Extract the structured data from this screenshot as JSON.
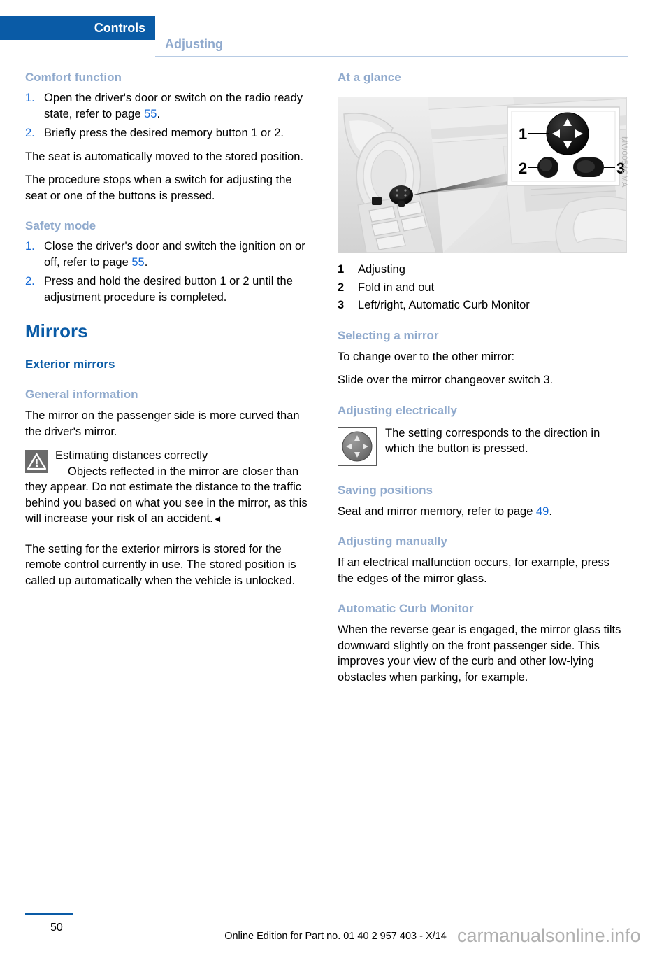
{
  "header": {
    "tab_label": "Controls",
    "section_label": "Adjusting"
  },
  "left_column": {
    "comfort_function": {
      "heading": "Comfort function",
      "steps": [
        {
          "num": "1.",
          "text_before": "Open the driver's door or switch on the radio ready state, refer to page ",
          "page_ref": "55",
          "text_after": "."
        },
        {
          "num": "2.",
          "text_before": "Briefly press the desired memory button 1 or 2.",
          "page_ref": "",
          "text_after": ""
        }
      ],
      "paragraphs": [
        "The seat is automatically moved to the stored position.",
        "The procedure stops when a switch for adjusting the seat or one of the buttons is pressed."
      ]
    },
    "safety_mode": {
      "heading": "Safety mode",
      "steps": [
        {
          "num": "1.",
          "text_before": "Close the driver's door and switch the ignition on or off, refer to page ",
          "page_ref": "55",
          "text_after": "."
        },
        {
          "num": "2.",
          "text_before": "Press and hold the desired button 1 or 2 until the adjustment procedure is completed.",
          "page_ref": "",
          "text_after": ""
        }
      ]
    },
    "mirrors": {
      "heading": "Mirrors",
      "subheading": "Exterior mirrors",
      "general_information": {
        "heading": "General information",
        "paragraph": "The mirror on the passenger side is more curved than the driver's mirror."
      },
      "warning": {
        "icon": "warning-triangle-icon",
        "title": "Estimating distances correctly",
        "text": "Objects reflected in the mirror are closer than they appear. Do not estimate the distance to the traffic behind you based on what you see in the mirror, as this will increase your risk of an accident.",
        "end_mark": "◄"
      },
      "closing_paragraph": "The setting for the exterior mirrors is stored for the remote control currently in use. The stored position is called up automatically when the vehicle is unlocked."
    }
  },
  "right_column": {
    "at_a_glance": {
      "heading": "At a glance",
      "figure": {
        "caption_code": "MW0054CMA",
        "callout_labels": [
          "1",
          "2",
          "3"
        ]
      },
      "legend": [
        {
          "num": "1",
          "label": "Adjusting"
        },
        {
          "num": "2",
          "label": "Fold in and out"
        },
        {
          "num": "3",
          "label": "Left/right, Automatic Curb Monitor"
        }
      ]
    },
    "selecting_a_mirror": {
      "heading": "Selecting a mirror",
      "paragraphs": [
        "To change over to the other mirror:",
        "Slide over the mirror changeover switch 3."
      ]
    },
    "adjusting_electrically": {
      "heading": "Adjusting electrically",
      "icon": "mirror-joystick-icon",
      "text": "The setting corresponds to the direction in which the button is pressed."
    },
    "saving_positions": {
      "heading": "Saving positions",
      "text_before": "Seat and mirror memory, refer to page ",
      "page_ref": "49",
      "text_after": "."
    },
    "adjusting_manually": {
      "heading": "Adjusting manually",
      "paragraph": "If an electrical malfunction occurs, for example, press the edges of the mirror glass."
    },
    "automatic_curb_monitor": {
      "heading": "Automatic Curb Monitor",
      "paragraph": "When the reverse gear is engaged, the mirror glass tilts downward slightly on the front passenger side. This improves your view of the curb and other low-lying obstacles when parking, for example."
    }
  },
  "footer": {
    "page_number": "50",
    "edition_text": "Online Edition for Part no. 01 40 2 957 403 - X/14",
    "watermark": "carmanualsonline.info"
  },
  "colors": {
    "brand_blue": "#0a5ba6",
    "light_blue_heading": "#90aacd",
    "page_ref_blue": "#1569d6",
    "rule_blue": "#b7cbe4"
  }
}
